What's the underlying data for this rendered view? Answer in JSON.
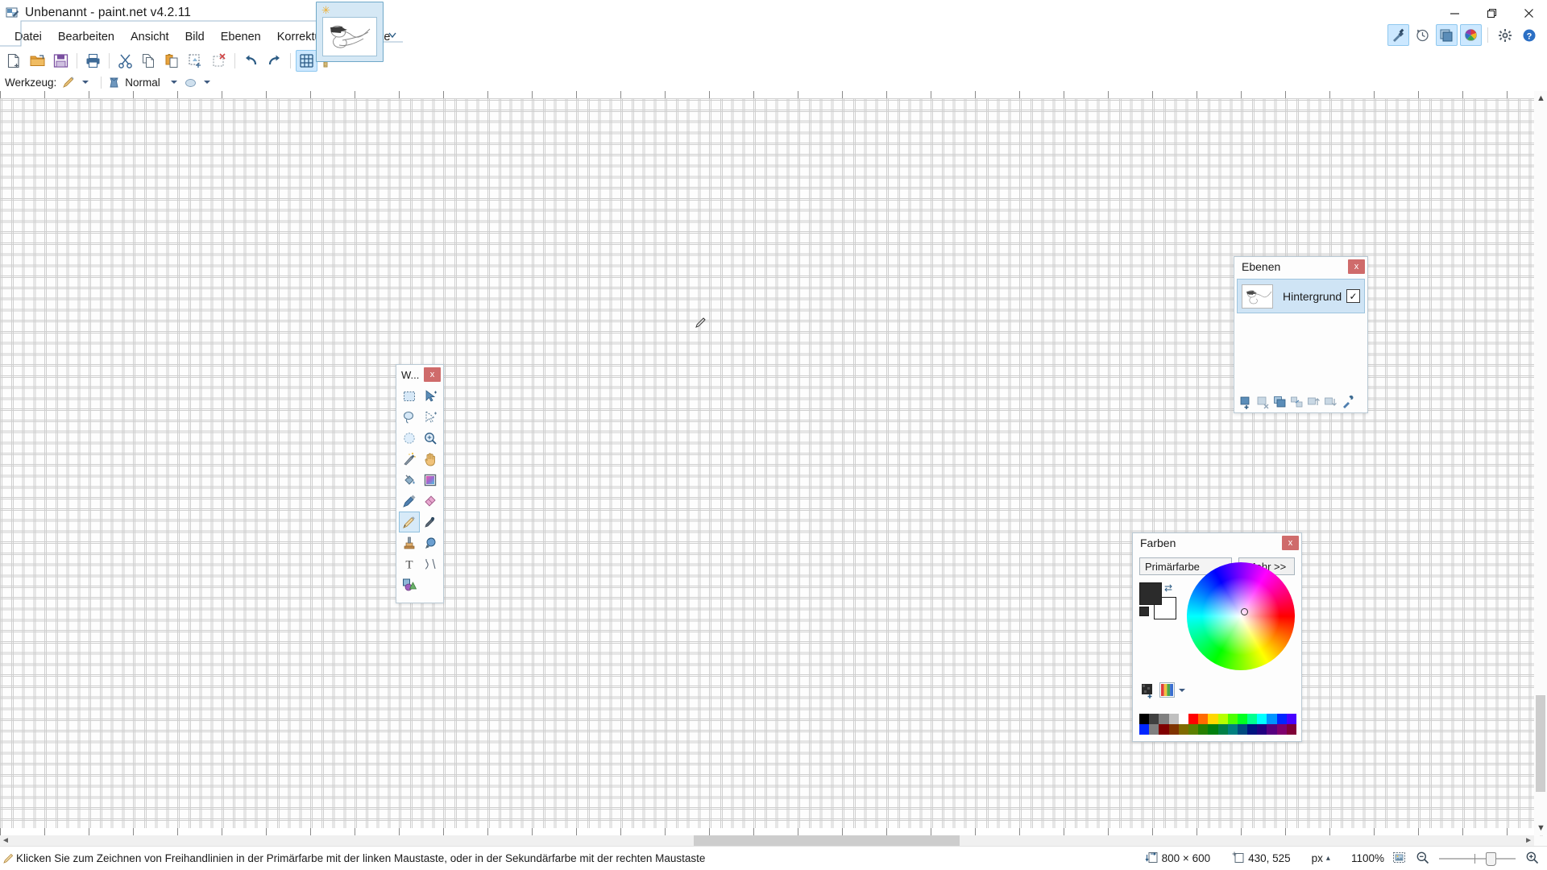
{
  "window": {
    "title": "Unbenannt - paint.net v4.2.11",
    "app_icon": "paintnet-icon",
    "minimize_label": "–",
    "maximize_label": "❐",
    "close_label": "✕"
  },
  "menubar": {
    "items": [
      {
        "label": "Datei",
        "name": "menu-datei"
      },
      {
        "label": "Bearbeiten",
        "name": "menu-bearbeiten"
      },
      {
        "label": "Ansicht",
        "name": "menu-ansicht"
      },
      {
        "label": "Bild",
        "name": "menu-bild"
      },
      {
        "label": "Ebenen",
        "name": "menu-ebenen"
      },
      {
        "label": "Korrekturen",
        "name": "menu-korrekturen"
      },
      {
        "label": "Effekte",
        "name": "menu-effekte"
      }
    ]
  },
  "titlebar_right_buttons": [
    {
      "name": "tools-toggle-icon",
      "label": "Werkzeuge",
      "active": true
    },
    {
      "name": "history-toggle-icon",
      "label": "Verlauf",
      "active": false
    },
    {
      "name": "layers-toggle-icon",
      "label": "Ebenen",
      "active": true
    },
    {
      "name": "colors-toggle-icon",
      "label": "Farben",
      "active": true
    },
    {
      "name": "settings-gear-icon",
      "label": "Einstellungen",
      "active": false
    },
    {
      "name": "help-icon",
      "label": "Hilfe",
      "active": false
    }
  ],
  "toolbar": {
    "buttons": [
      {
        "name": "new-icon",
        "label": "Neu"
      },
      {
        "name": "open-folder-icon",
        "label": "Öffnen"
      },
      {
        "name": "save-icon",
        "label": "Speichern"
      },
      {
        "name": "print-icon",
        "label": "Drucken"
      },
      {
        "name": "cut-scissors-icon",
        "label": "Ausschneiden"
      },
      {
        "name": "copy-icon",
        "label": "Kopieren"
      },
      {
        "name": "paste-icon",
        "label": "Einfügen"
      },
      {
        "name": "crop-to-selection-icon",
        "label": "Auf Auswahl zuschneiden"
      },
      {
        "name": "deselect-icon",
        "label": "Auswahl aufheben"
      },
      {
        "name": "undo-icon",
        "label": "Rückgängig"
      },
      {
        "name": "redo-icon",
        "label": "Wiederholen"
      },
      {
        "name": "grid-icon",
        "label": "Raster",
        "active": true
      },
      {
        "name": "ruler-icon",
        "label": "Lineale"
      }
    ]
  },
  "tool_options": {
    "tool_label": "Werkzeug:",
    "tool_icon": "pencil-icon",
    "blend_label": "Normal",
    "blend_icon": "blend-mode-icon",
    "antialias_icon": "antialiasing-icon"
  },
  "document_tab": {
    "name": "Unbenannt",
    "badge_icon": "unsaved-star-icon",
    "thumbnail_icon": "sketch-thumbnail"
  },
  "tools_window": {
    "title": "W...",
    "close_label": "x",
    "tools": [
      {
        "name": "tool-rectangle-select",
        "label": "Rechteckauswahl",
        "icon": "rectangle-select-icon",
        "selected": false
      },
      {
        "name": "tool-move-selected",
        "label": "Ausgewählte Pixel verschieben",
        "icon": "move-selected-icon",
        "selected": false
      },
      {
        "name": "tool-lasso-select",
        "label": "Lasso-Auswahl",
        "icon": "lasso-select-icon",
        "selected": false
      },
      {
        "name": "tool-move-selection",
        "label": "Auswahl verschieben",
        "icon": "move-selection-icon",
        "selected": false
      },
      {
        "name": "tool-ellipse-select",
        "label": "Ellipsenauswahl",
        "icon": "ellipse-select-icon",
        "selected": false
      },
      {
        "name": "tool-zoom",
        "label": "Zoom",
        "icon": "magnifier-icon",
        "selected": false
      },
      {
        "name": "tool-magic-wand",
        "label": "Zauberstab",
        "icon": "magic-wand-icon",
        "selected": false
      },
      {
        "name": "tool-pan",
        "label": "Verschieben",
        "icon": "hand-pan-icon",
        "selected": false
      },
      {
        "name": "tool-paint-bucket",
        "label": "Füllwerkzeug",
        "icon": "paint-bucket-icon",
        "selected": false
      },
      {
        "name": "tool-gradient",
        "label": "Farbverlauf",
        "icon": "gradient-icon",
        "selected": false
      },
      {
        "name": "tool-paintbrush",
        "label": "Pinsel",
        "icon": "paintbrush-icon",
        "selected": false
      },
      {
        "name": "tool-eraser",
        "label": "Radierer",
        "icon": "eraser-icon",
        "selected": false
      },
      {
        "name": "tool-pencil",
        "label": "Stift",
        "icon": "pencil-tool-icon",
        "selected": true
      },
      {
        "name": "tool-color-picker",
        "label": "Pipette",
        "icon": "color-picker-icon",
        "selected": false
      },
      {
        "name": "tool-clone-stamp",
        "label": "Klonstempel",
        "icon": "clone-stamp-icon",
        "selected": false
      },
      {
        "name": "tool-recolor",
        "label": "Umfärben",
        "icon": "recolor-icon",
        "selected": false
      },
      {
        "name": "tool-text",
        "label": "Text",
        "icon": "text-icon",
        "selected": false
      },
      {
        "name": "tool-line-curve",
        "label": "Linie/Kurve",
        "icon": "line-curve-icon",
        "selected": false
      },
      {
        "name": "tool-shapes",
        "label": "Formen",
        "icon": "shapes-icon",
        "selected": false
      }
    ]
  },
  "layers_window": {
    "title": "Ebenen",
    "close_label": "x",
    "layers": [
      {
        "name": "Hintergrund",
        "visible": true,
        "check_glyph": "✓",
        "selected": true
      }
    ],
    "toolbar_buttons": [
      {
        "name": "add-layer-icon",
        "label": "Ebene hinzufügen"
      },
      {
        "name": "delete-layer-icon",
        "label": "Ebene löschen"
      },
      {
        "name": "duplicate-layer-icon",
        "label": "Ebene duplizieren"
      },
      {
        "name": "merge-layer-down-icon",
        "label": "Ebene nach unten zusammenführen"
      },
      {
        "name": "move-layer-up-icon",
        "label": "Ebene nach oben"
      },
      {
        "name": "move-layer-down-icon",
        "label": "Ebene nach unten"
      },
      {
        "name": "layer-properties-icon",
        "label": "Ebeneneigenschaften"
      }
    ]
  },
  "colors_window": {
    "title": "Farben",
    "close_label": "x",
    "mode_select": {
      "value": "Primärfarbe",
      "caret": "⌄"
    },
    "more_button": "Mehr >>",
    "primary_color": "#2b2b2b",
    "secondary_color": "#ffffff",
    "swap_icon": "swap-colors-icon",
    "palette_buttons": [
      {
        "name": "add-color-to-palette-icon",
        "label": "Farbe zur Palette hinzufügen"
      },
      {
        "name": "palette-select-icon",
        "label": "Palette auswählen"
      }
    ],
    "palette_row1": [
      "#000000",
      "#404040",
      "#808080",
      "#c0c0c0",
      "#ffffff",
      "#ff0000",
      "#ff6a00",
      "#ffd800",
      "#b6ff00",
      "#4cff00",
      "#00ff21",
      "#00ff90",
      "#00ffff",
      "#0094ff",
      "#0026ff",
      "#4800ff",
      "#b200ff",
      "#ff00dc",
      "#ff006e"
    ],
    "palette_row2": [
      "#0026ff",
      "#7f7f7f",
      "#7f0000",
      "#7f3300",
      "#7f6a00",
      "#5b7f00",
      "#267f00",
      "#007f0e",
      "#007f46",
      "#007f7f",
      "#004a7f",
      "#00137f",
      "#21007f",
      "#57007f",
      "#7f006e",
      "#7f0037"
    ]
  },
  "canvas": {
    "cursor_icon": "pencil-cursor",
    "grid_visible": true,
    "rulers_visible": true
  },
  "statusbar": {
    "tool_icon": "pencil-icon",
    "hint": "Klicken Sie zum Zeichnen von Freihandlinien in der Primärfarbe mit der linken Maustaste, oder in der Sekundärfarbe mit der rechten Maustaste",
    "image_size_icon": "image-size-icon",
    "image_size": "800 × 600",
    "cursor_pos_icon": "cursor-position-icon",
    "cursor_position": "430, 525",
    "unit": "px",
    "unit_caret": "▴",
    "zoom_level": "1100%",
    "fit_icon": "fit-to-window-icon",
    "zoom_out_icon": "zoom-out-icon",
    "zoom_in_icon": "zoom-in-icon"
  },
  "colors": {
    "accent": "#2b5b84",
    "selection_blue": "#cce8ff",
    "close_red": "#cf6b6b",
    "panel_border": "#b9c9d4"
  }
}
